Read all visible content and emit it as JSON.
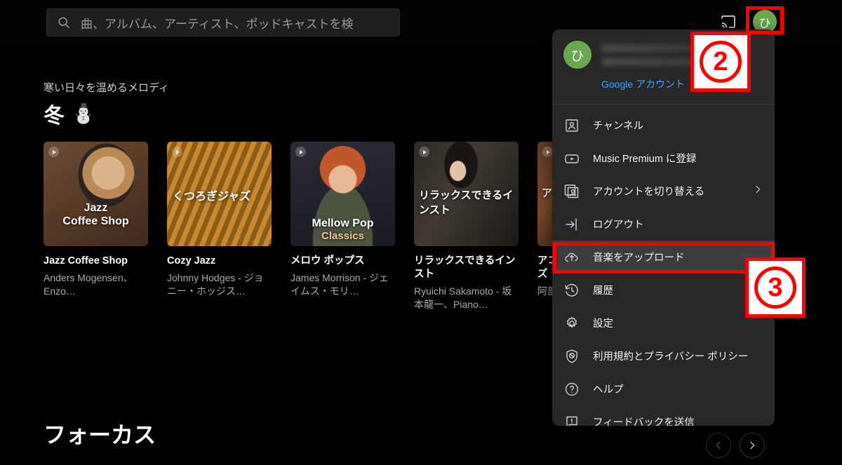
{
  "topbar": {
    "search": {
      "placeholder": "曲、アルバム、アーティスト、ポッドキャストを検",
      "value": "",
      "icon": "search-icon"
    },
    "cast_icon": "cast-icon",
    "avatar_initial": "ひ"
  },
  "shelf": {
    "subtitle": "寒い日々を温めるメロディ",
    "title": "冬",
    "title_emoji": "⛄",
    "cards": [
      {
        "title": "Jazz Coffee Shop",
        "subtitle": "Anders Mogensen、Enzo…",
        "art_text_line1": "Jazz",
        "art_text_line2": "Coffee Shop"
      },
      {
        "title": "Cozy Jazz",
        "subtitle": "Johnny Hodges - ジョニー・ホッジス…",
        "art_text_line1": "くつろぎジャズ",
        "art_text_line2": ""
      },
      {
        "title": "メロウ ポップス",
        "subtitle": "James Morrison - ジェイムス・モリ…",
        "art_text_line1": "Mellow Pop",
        "art_text_line2": "Classics"
      },
      {
        "title": "リラックスできるインスト",
        "subtitle": "Ryuichi Sakamoto - 坂本龍一、Piano…",
        "art_text_line1": "リラックスできるインスト",
        "art_text_line2": ""
      },
      {
        "title": "アコースティック ジャズ",
        "subtitle": "阿部博",
        "art_text_line1": "ア",
        "art_text_line2": ""
      }
    ]
  },
  "focus_section": {
    "title": "フォーカス",
    "prev_label": "‹",
    "next_label": "›"
  },
  "account_menu": {
    "avatar_initial": "ひ",
    "name_masked": "",
    "email_masked": "",
    "google_account_link": "Google アカウント",
    "items": [
      {
        "label": "チャンネル",
        "icon": "channel-person-icon",
        "chevron": "",
        "highlighted": false
      },
      {
        "label": "Music Premium に登録",
        "icon": "youtube-play-icon",
        "chevron": "",
        "highlighted": false
      },
      {
        "label": "アカウントを切り替える",
        "icon": "switch-account-icon",
        "chevron": "›",
        "highlighted": false
      },
      {
        "label": "ログアウト",
        "icon": "logout-icon",
        "chevron": "",
        "highlighted": false
      },
      {
        "label": "音楽をアップロード",
        "icon": "cloud-upload-icon",
        "chevron": "",
        "highlighted": true
      },
      {
        "label": "履歴",
        "icon": "history-clock-icon",
        "chevron": "",
        "highlighted": false
      },
      {
        "label": "設定",
        "icon": "gear-icon",
        "chevron": "",
        "highlighted": false
      },
      {
        "label": "利用規約とプライバシー ポリシー",
        "icon": "shield-policy-icon",
        "chevron": "",
        "highlighted": false
      },
      {
        "label": "ヘルプ",
        "icon": "help-question-icon",
        "chevron": "",
        "highlighted": false
      },
      {
        "label": "フィードバックを送信",
        "icon": "feedback-flag-icon",
        "chevron": "",
        "highlighted": false
      }
    ]
  },
  "annotations": {
    "color": "#FF0000",
    "step2": "②",
    "step3": "③",
    "step2_digit": "2",
    "step3_digit": "3"
  }
}
